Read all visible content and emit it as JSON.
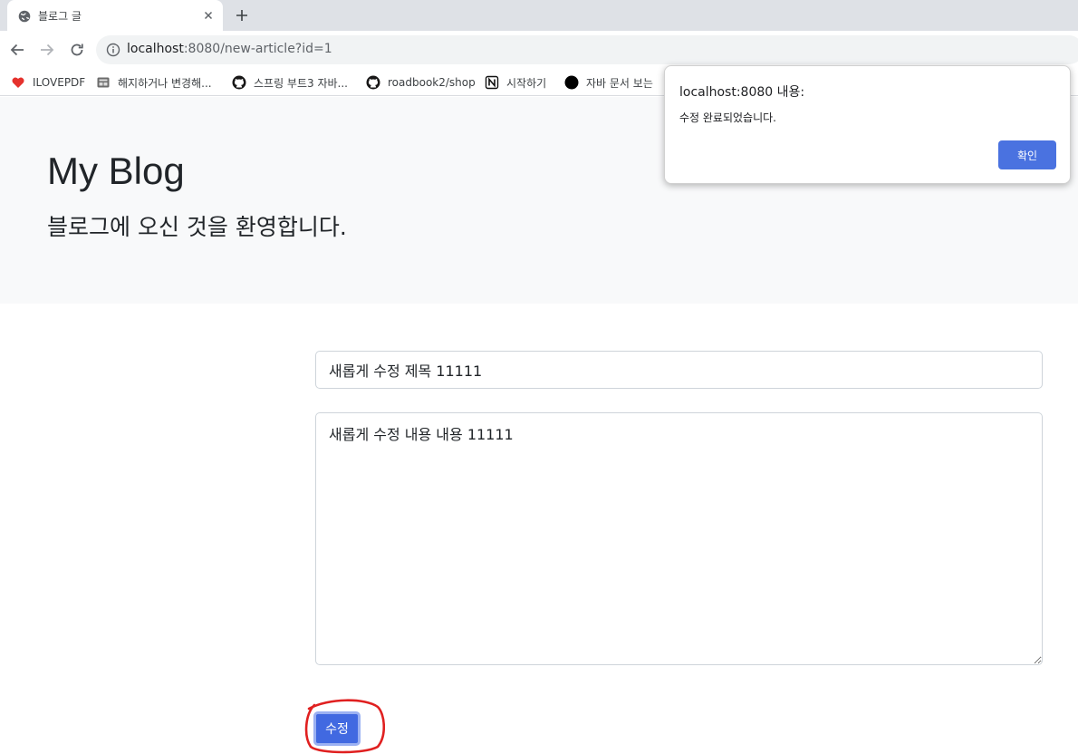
{
  "browser": {
    "tab_title": "블로그 글",
    "url_host": "localhost",
    "url_rest": ":8080/new-article?id=1",
    "bookmarks": [
      {
        "label": "ILOVEPDF",
        "icon": "heart-icon"
      },
      {
        "label": "해지하거나 변경해...",
        "icon": "page-icon"
      },
      {
        "label": "스프링 부트3 자바...",
        "icon": "github-icon"
      },
      {
        "label": "roadbook2/shop",
        "icon": "github-icon"
      },
      {
        "label": "시작하기",
        "icon": "notion-icon"
      },
      {
        "label": "자바 문서 보는",
        "icon": "black-circle-icon"
      }
    ]
  },
  "hero": {
    "title": "My Blog",
    "subtitle": "블로그에 오신 것을 환영합니다."
  },
  "form": {
    "title_value": "새롭게 수정 제목 11111",
    "content_value": "새롭게 수정 내용 내용 11111",
    "submit_label": "수정"
  },
  "alert": {
    "title": "localhost:8080 내용:",
    "message": "수정 완료되었습니다.",
    "ok_label": "확인"
  },
  "colors": {
    "accent": "#4169e1",
    "hero_bg": "#f8f9fa",
    "annotation": "#e02020"
  }
}
